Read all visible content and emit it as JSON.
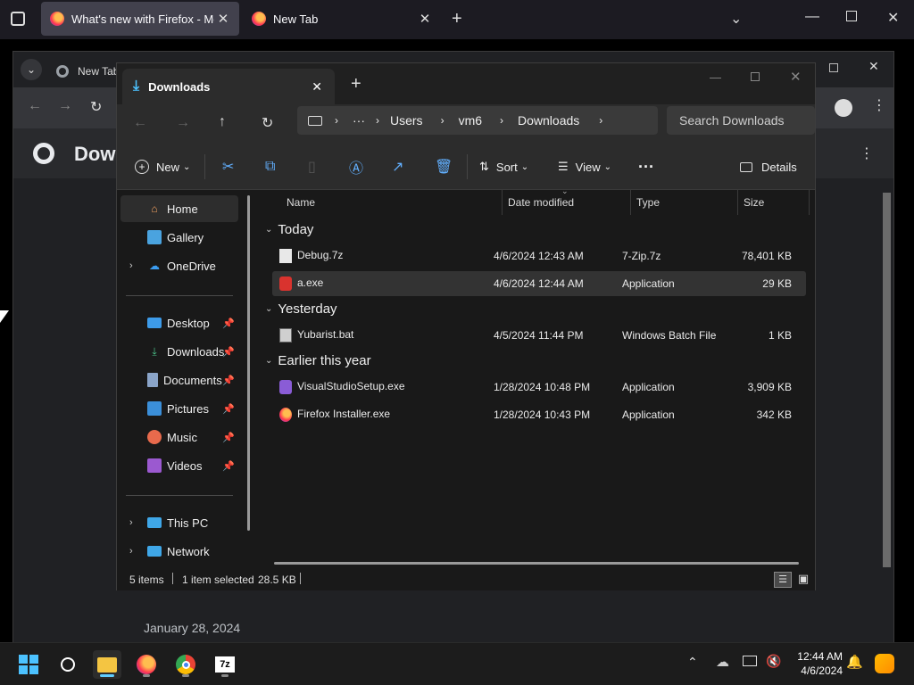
{
  "firefox": {
    "tabs": [
      {
        "title": "What's new with Firefox - More",
        "active": true
      },
      {
        "title": "New Tab",
        "active": false
      }
    ]
  },
  "chrome": {
    "tab_title": "New Tab",
    "page_heading": "Down",
    "date_label": "January 28, 2024"
  },
  "explorer": {
    "tab_title": "Downloads",
    "breadcrumb": [
      "Users",
      "vm6",
      "Downloads"
    ],
    "search_placeholder": "Search Downloads",
    "commands": {
      "new": "New",
      "sort": "Sort",
      "view": "View",
      "details": "Details"
    },
    "nav": {
      "top": [
        {
          "label": "Home",
          "icon": "home-icon",
          "selected": true
        },
        {
          "label": "Gallery",
          "icon": "gallery-icon"
        },
        {
          "label": "OneDrive",
          "icon": "cloud-icon",
          "expandable": true
        }
      ],
      "quick": [
        {
          "label": "Desktop",
          "icon": "desktop-icon"
        },
        {
          "label": "Downloads",
          "icon": "download-icon"
        },
        {
          "label": "Documents",
          "icon": "document-icon"
        },
        {
          "label": "Pictures",
          "icon": "picture-icon"
        },
        {
          "label": "Music",
          "icon": "music-icon"
        },
        {
          "label": "Videos",
          "icon": "video-icon"
        }
      ],
      "bottom": [
        {
          "label": "This PC",
          "icon": "pc-icon"
        },
        {
          "label": "Network",
          "icon": "network-icon"
        }
      ]
    },
    "columns": {
      "name": "Name",
      "date": "Date modified",
      "type": "Type",
      "size": "Size"
    },
    "groups": [
      {
        "label": "Today",
        "files": [
          {
            "name": "Debug.7z",
            "date": "4/6/2024 12:43 AM",
            "type": "7-Zip.7z",
            "size": "78,401 KB",
            "icon": "file-icon"
          },
          {
            "name": "a.exe",
            "date": "4/6/2024 12:44 AM",
            "type": "Application",
            "size": "29 KB",
            "icon": "exe-icon",
            "selected": true
          }
        ]
      },
      {
        "label": "Yesterday",
        "files": [
          {
            "name": "Yubarist.bat",
            "date": "4/5/2024 11:44 PM",
            "type": "Windows Batch File",
            "size": "1 KB",
            "icon": "batch-icon"
          }
        ]
      },
      {
        "label": "Earlier this year",
        "files": [
          {
            "name": "VisualStudioSetup.exe",
            "date": "1/28/2024 10:48 PM",
            "type": "Application",
            "size": "3,909 KB",
            "icon": "vs-icon"
          },
          {
            "name": "Firefox Installer.exe",
            "date": "1/28/2024 10:43 PM",
            "type": "Application",
            "size": "342 KB",
            "icon": "firefox-icon"
          }
        ]
      }
    ],
    "status": {
      "items": "5 items",
      "selected": "1 item selected",
      "size": "28.5 KB"
    }
  },
  "taskbar": {
    "time": "12:44 AM",
    "date": "4/6/2024"
  },
  "colors": {
    "accent": "#60cdff",
    "folder": "#f4c542"
  }
}
